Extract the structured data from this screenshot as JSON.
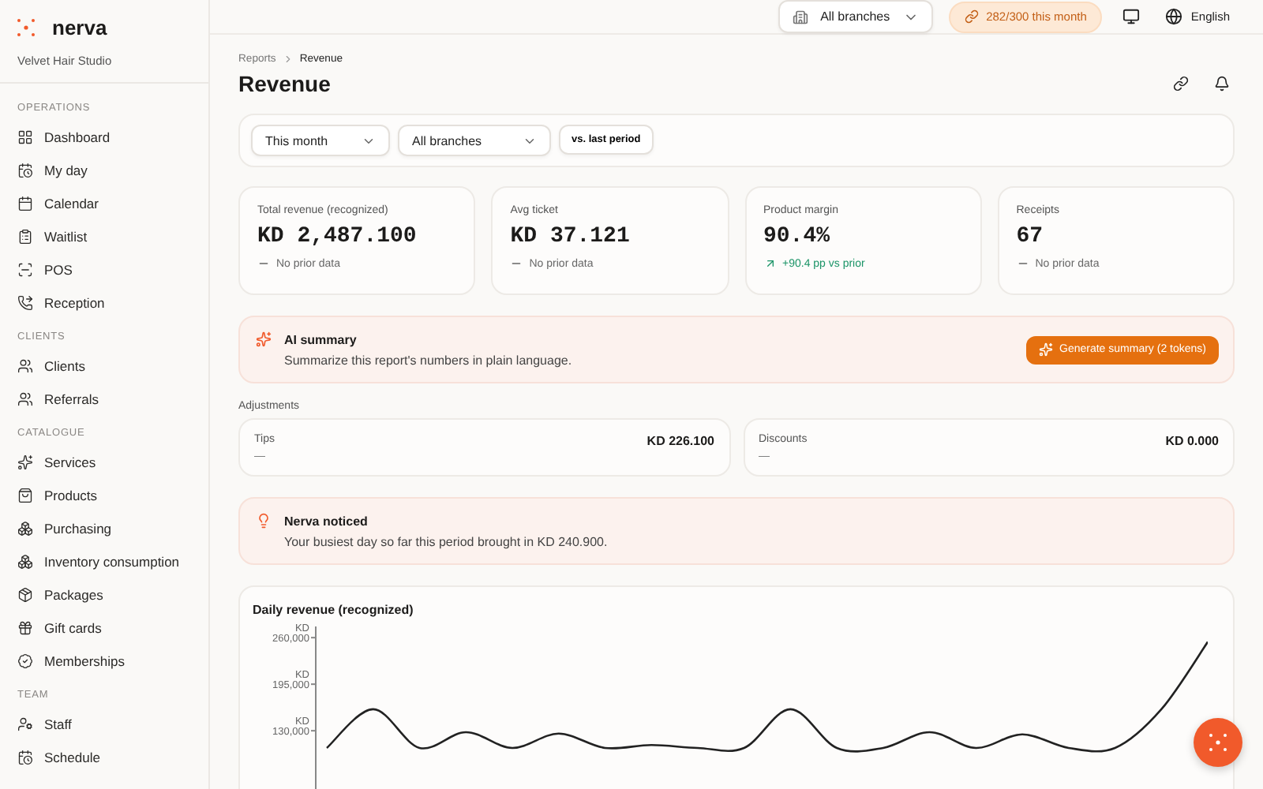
{
  "brand": {
    "name": "nerva",
    "workspace": "Velvet Hair Studio"
  },
  "sidebar": {
    "sections": [
      {
        "title": "OPERATIONS",
        "items": [
          {
            "label": "Dashboard",
            "selected": false
          },
          {
            "label": "My day",
            "selected": false
          },
          {
            "label": "Calendar",
            "selected": false
          },
          {
            "label": "Waitlist",
            "selected": false
          },
          {
            "label": "POS",
            "selected": false
          },
          {
            "label": "Reception",
            "selected": false
          }
        ]
      },
      {
        "title": "CLIENTS",
        "items": [
          {
            "label": "Clients",
            "selected": false
          },
          {
            "label": "Referrals",
            "selected": false
          }
        ]
      },
      {
        "title": "CATALOGUE",
        "items": [
          {
            "label": "Services",
            "selected": false
          },
          {
            "label": "Products",
            "selected": false
          },
          {
            "label": "Purchasing",
            "selected": false
          },
          {
            "label": "Inventory consumption",
            "selected": false
          },
          {
            "label": "Packages",
            "selected": false
          },
          {
            "label": "Gift cards",
            "selected": false
          },
          {
            "label": "Memberships",
            "selected": false
          }
        ]
      },
      {
        "title": "TEAM",
        "items": [
          {
            "label": "Staff",
            "selected": false
          },
          {
            "label": "Schedule",
            "selected": false
          }
        ]
      }
    ]
  },
  "topbar": {
    "branch": "All branches",
    "usage": "282/300 this month",
    "language": "English"
  },
  "breadcrumb": [
    "Reports",
    "Revenue"
  ],
  "title": "Revenue",
  "filters": {
    "period": "This month",
    "branch": "All branches",
    "compare": "vs. last period"
  },
  "kpis": [
    {
      "label": "Total revenue (recognized)",
      "value": "KD 2,487.100",
      "kind": "flat",
      "note": "No prior data"
    },
    {
      "label": "Avg ticket",
      "value": "KD 37.121",
      "kind": "flat",
      "note": "No prior data"
    },
    {
      "label": "Product margin",
      "value": "90.4%",
      "kind": "up",
      "note": "+90.4 pp vs prior"
    },
    {
      "label": "Receipts",
      "value": "67",
      "kind": "flat",
      "note": "No prior data"
    }
  ],
  "ai_summary": {
    "title": "AI summary",
    "text": "Summarize this report's numbers in plain language.",
    "button": "Generate summary (2 tokens)"
  },
  "adjustments": {
    "title": "Adjustments",
    "items": [
      {
        "label": "Tips",
        "value": "KD 226.100",
        "note": "—"
      },
      {
        "label": "Discounts",
        "value": "KD 0.000",
        "note": "—"
      }
    ]
  },
  "insight": {
    "title": "Nerva noticed",
    "text": "Your busiest day so far this period brought in KD 240.900."
  },
  "chart": {
    "title": "Daily revenue (recognized)",
    "chart_data": {
      "type": "line",
      "ylim": [
        0,
        280000
      ],
      "ylabel": "KD",
      "yticks": [
        {
          "value": 260000,
          "label": "260,000"
        },
        {
          "value": 195000,
          "label": "195,000"
        },
        {
          "value": 130000,
          "label": "130,000"
        }
      ],
      "series": [
        {
          "color": "#222222",
          "values": [
            106000,
            160000,
            106000,
            128000,
            106000,
            126000,
            106000,
            110000,
            106000,
            106000,
            160000,
            106000,
            106000,
            128000,
            106000,
            125000,
            106000,
            106000,
            160000,
            254000
          ]
        }
      ]
    }
  }
}
